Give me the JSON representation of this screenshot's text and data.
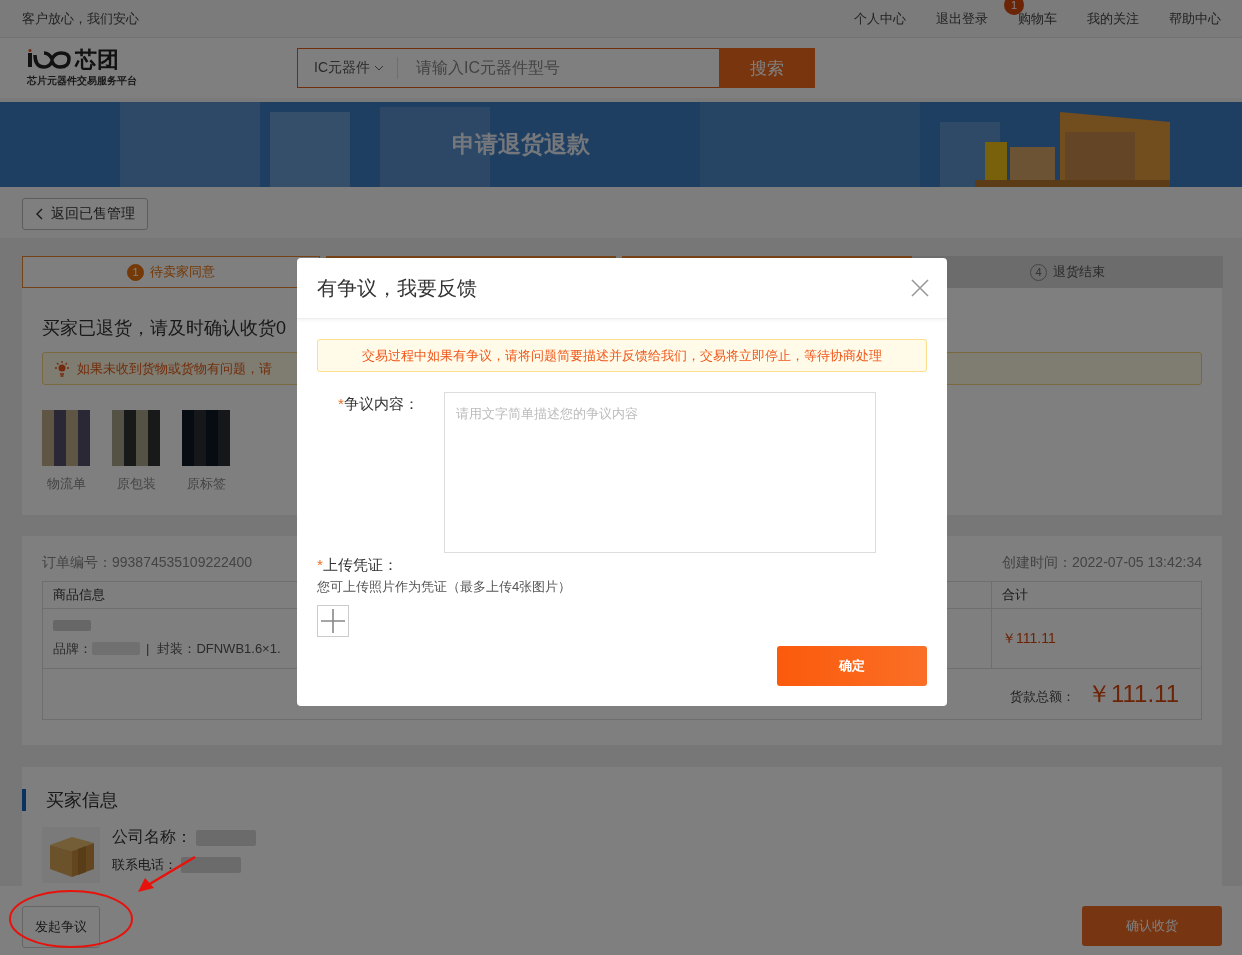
{
  "top_bar": {
    "slogan": "客户放心，我们安心",
    "links": [
      {
        "label": "个人中心"
      },
      {
        "label": "退出登录"
      },
      {
        "label": "购物车",
        "badge": "1"
      },
      {
        "label": "我的关注"
      },
      {
        "label": "帮助中心"
      }
    ]
  },
  "header": {
    "logo": {
      "name": "芯团",
      "tagline": "芯片元器件交易服务平台"
    },
    "search": {
      "category": "IC元器件",
      "placeholder": "请输入IC元器件型号",
      "button": "搜索"
    }
  },
  "banner": {
    "title": "申请退货退款"
  },
  "back_button": "返回已售管理",
  "steps": [
    {
      "number": "1",
      "label": "待卖家同意",
      "selected": true
    },
    {
      "number": "4",
      "label": "退货结束",
      "selected": false
    }
  ],
  "status_card": {
    "message": "买家已退货，请及时确认收货0",
    "notice": "如果未收到货物或货物有问题，请",
    "proofs": [
      {
        "label": "物流单"
      },
      {
        "label": "原包装"
      },
      {
        "label": "原标签"
      }
    ]
  },
  "order": {
    "number": "订单编号：993874535109222400",
    "created": "创建时间：2022-07-05 13:42:34",
    "columns": [
      "商品信息",
      "合计"
    ],
    "rows": [
      {
        "brand_label": "品牌：",
        "separator": "|",
        "package": "封装：DFNWB1.6×1.",
        "total": "￥111.11"
      }
    ],
    "sum_label": "货款总额：",
    "sum": "￥111.11"
  },
  "buyer": {
    "title": "买家信息",
    "fields": [
      {
        "kind": "primary",
        "label": "公司名称："
      },
      {
        "kind": "secondary",
        "label": "联系电话："
      }
    ]
  },
  "footer": {
    "dispute_button": "发起争议",
    "confirm_button": "确认收货"
  },
  "modal": {
    "title": "有争议，我要反馈",
    "alert": "交易过程中如果有争议，请将问题简要描述并反馈给我们，交易将立即停止，等待协商处理",
    "fields": [
      {
        "kind": "textarea",
        "required_mark": "*",
        "label": "争议内容：",
        "placeholder": "请用文字简单描述您的争议内容"
      },
      {
        "kind": "upload",
        "required_mark": "*",
        "label": "上传凭证：",
        "hint": "您可上传照片作为凭证（最多上传4张图片）"
      }
    ],
    "submit": "确定"
  }
}
